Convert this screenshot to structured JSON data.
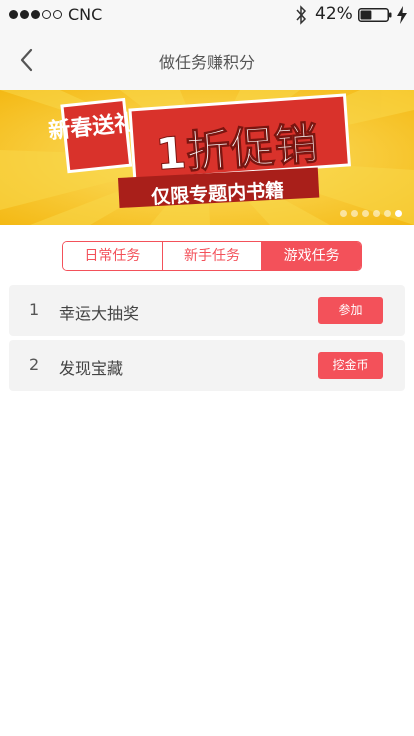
{
  "status_bar": {
    "carrier": "CNC",
    "battery_percent": "42%",
    "battery_level": 0.42
  },
  "nav": {
    "title": "做任务赚积分"
  },
  "banner": {
    "text_left": "新春送礼",
    "text_main": "1折促销",
    "text_sub": "仅限专题内书籍",
    "page_count": 6,
    "active_page": 6
  },
  "tabs": [
    {
      "label": "日常任务",
      "active": false
    },
    {
      "label": "新手任务",
      "active": false
    },
    {
      "label": "游戏任务",
      "active": true
    }
  ],
  "tasks": [
    {
      "num": "1",
      "name": "幸运大抽奖",
      "action": "参加"
    },
    {
      "num": "2",
      "name": "发现宝藏",
      "action": "挖金币"
    }
  ],
  "colors": {
    "accent": "#f3515a",
    "banner_yellow": "#f6c821",
    "banner_red": "#d9322b"
  }
}
